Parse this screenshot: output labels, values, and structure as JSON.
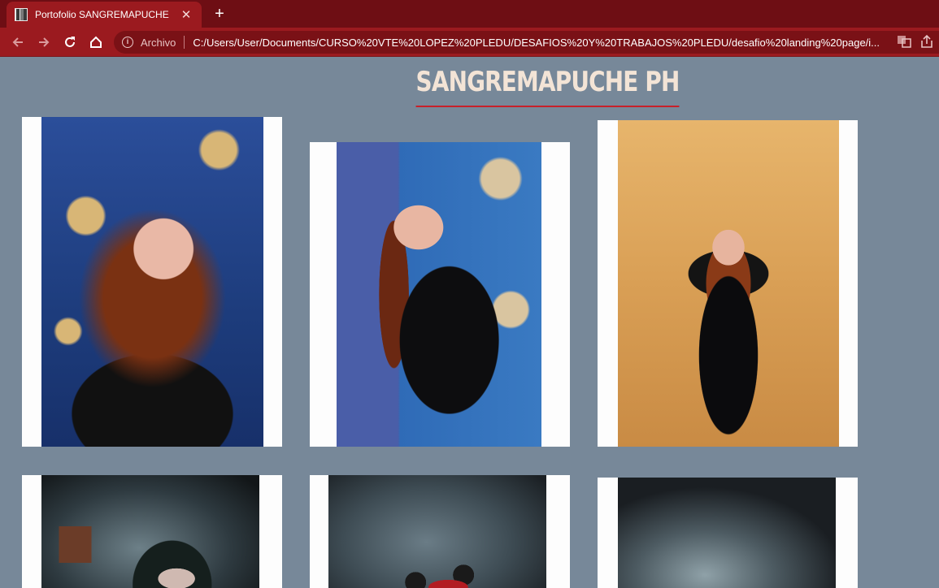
{
  "browser": {
    "tab_title": "Portofolio SANGREMAPUCHE",
    "tab_close": "✕",
    "new_tab": "+",
    "security_label": "Archivo",
    "url": "C:/Users/User/Documents/CURSO%20VTE%20LOPEZ%20PLEDU/DESAFIOS%20Y%20TRABAJOS%20PLEDU/desafio%20landing%20page/i...",
    "icons": [
      "back-arrow-icon",
      "forward-arrow-icon",
      "reload-icon",
      "home-icon",
      "info-icon",
      "translate-icon",
      "share-icon"
    ]
  },
  "page": {
    "title": "SANGREMAPUCHE PH",
    "photos": [
      {
        "name": "photo-1"
      },
      {
        "name": "photo-2"
      },
      {
        "name": "photo-3"
      },
      {
        "name": "photo-4"
      },
      {
        "name": "photo-5"
      },
      {
        "name": "photo-6"
      }
    ]
  },
  "colors": {
    "page_background": "#778899",
    "browser_frame": "#9b1a1f",
    "title_text": "#f3e4d6",
    "title_underline": "#c8202a"
  }
}
